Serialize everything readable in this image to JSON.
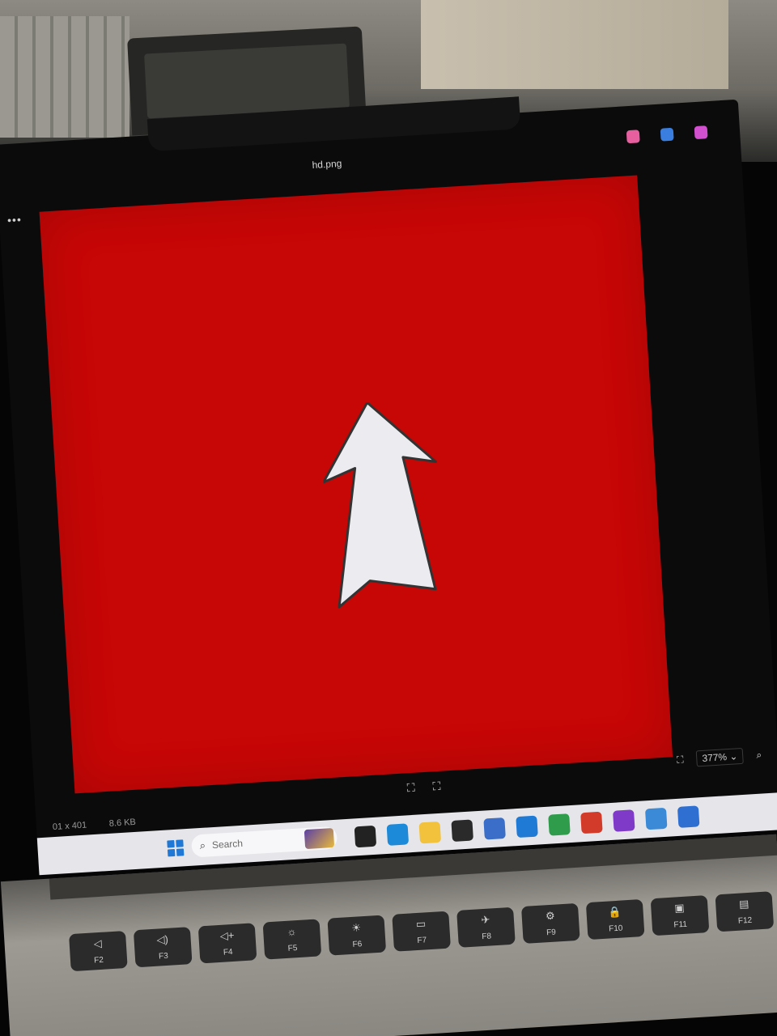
{
  "window": {
    "title": "hd.png",
    "menu_icon": "more-horizontal-icon"
  },
  "title_icons": [
    {
      "name": "copilot-icon",
      "color": "#e85fa0"
    },
    {
      "name": "paint-icon",
      "color": "#3a7ee0"
    },
    {
      "name": "designer-icon",
      "color": "#d24fd0"
    }
  ],
  "image": {
    "background_color": "#c70606",
    "arrow_fill": "#ececf0",
    "arrow_stroke": "#333333",
    "arrow_direction": "up"
  },
  "statusbar": {
    "dimensions": "01 x 401",
    "file_size": "8.6 KB",
    "zoom": "377%",
    "zoom_chevron": "⌄",
    "zoom_in_icon": "⌕",
    "fit_icon": "⛶",
    "center_icons": [
      "⛶",
      "⛶"
    ]
  },
  "taskbar": {
    "search_placeholder": "Search",
    "search_icon": "⌕",
    "apps": [
      {
        "name": "task-view-icon",
        "color": "#222222"
      },
      {
        "name": "edge-icon",
        "color": "#1c8ad8"
      },
      {
        "name": "file-explorer-icon",
        "color": "#f2c23c"
      },
      {
        "name": "terminal-icon",
        "color": "#2a2a2a"
      },
      {
        "name": "cube-app-icon",
        "color": "#3a6ec8"
      },
      {
        "name": "vscode-icon",
        "color": "#1f7ad6"
      },
      {
        "name": "chrome-icon",
        "color": "#2e9c4a"
      },
      {
        "name": "chrome-profile-icon",
        "color": "#d23a2a"
      },
      {
        "name": "chrome-profile-2-icon",
        "color": "#7f3ac8"
      },
      {
        "name": "cloud-app-icon",
        "color": "#3a8ad8"
      },
      {
        "name": "paint-app-icon",
        "color": "#2f6fd2"
      }
    ]
  },
  "keyboard": {
    "row1": [
      {
        "glyph": "◁",
        "label": "F2"
      },
      {
        "glyph": "◁)",
        "label": "F3"
      },
      {
        "glyph": "◁+",
        "label": "F4"
      },
      {
        "glyph": "☼",
        "label": "F5"
      },
      {
        "glyph": "☀",
        "label": "F6"
      },
      {
        "glyph": "▭",
        "label": "F7"
      },
      {
        "glyph": "✈",
        "label": "F8"
      },
      {
        "glyph": "⚙",
        "label": "F9"
      },
      {
        "glyph": "🔒",
        "label": "F10"
      },
      {
        "glyph": "▣",
        "label": "F11"
      },
      {
        "glyph": "▤",
        "label": "F12"
      }
    ]
  }
}
